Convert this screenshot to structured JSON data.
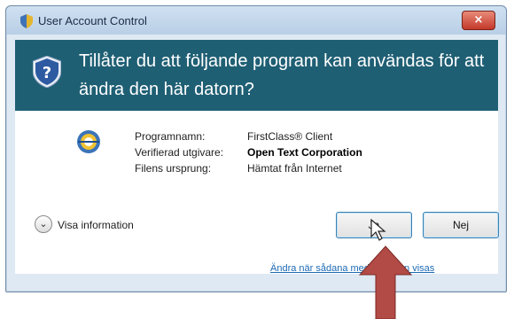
{
  "window": {
    "title": "User Account Control",
    "close_label": "×"
  },
  "banner": {
    "text": "Tillåter du att följande program kan användas för att ändra den här datorn?"
  },
  "info": {
    "program_name_label": "Programnamn:",
    "program_name_value": "FirstClass® Client",
    "publisher_label": "Verifierad utgivare:",
    "publisher_value": "Open Text Corporation",
    "origin_label": "Filens ursprung:",
    "origin_value": "Hämtat från Internet"
  },
  "details": {
    "toggle_glyph": "⌄",
    "label": "Visa information"
  },
  "buttons": {
    "yes_label": "Ja",
    "no_label": "Nej"
  },
  "footer": {
    "link_text": "Ändra när sådana meddelanden visas"
  },
  "colors": {
    "banner": "#1f5f74",
    "annotation_arrow": "#b24a45"
  }
}
